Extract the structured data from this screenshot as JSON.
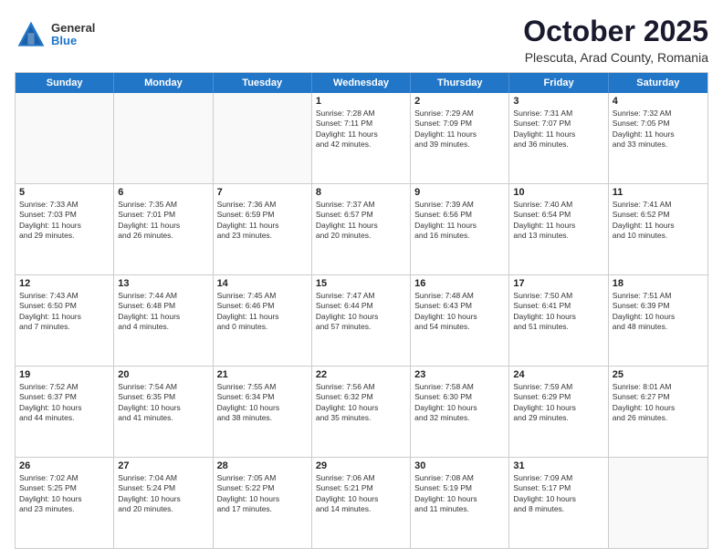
{
  "header": {
    "logo": {
      "general": "General",
      "blue": "Blue"
    },
    "title": "October 2025",
    "subtitle": "Plescuta, Arad County, Romania"
  },
  "weekdays": [
    "Sunday",
    "Monday",
    "Tuesday",
    "Wednesday",
    "Thursday",
    "Friday",
    "Saturday"
  ],
  "rows": [
    [
      {
        "day": "",
        "lines": [],
        "empty": true
      },
      {
        "day": "",
        "lines": [],
        "empty": true
      },
      {
        "day": "",
        "lines": [],
        "empty": true
      },
      {
        "day": "1",
        "lines": [
          "Sunrise: 7:28 AM",
          "Sunset: 7:11 PM",
          "Daylight: 11 hours",
          "and 42 minutes."
        ],
        "empty": false
      },
      {
        "day": "2",
        "lines": [
          "Sunrise: 7:29 AM",
          "Sunset: 7:09 PM",
          "Daylight: 11 hours",
          "and 39 minutes."
        ],
        "empty": false
      },
      {
        "day": "3",
        "lines": [
          "Sunrise: 7:31 AM",
          "Sunset: 7:07 PM",
          "Daylight: 11 hours",
          "and 36 minutes."
        ],
        "empty": false
      },
      {
        "day": "4",
        "lines": [
          "Sunrise: 7:32 AM",
          "Sunset: 7:05 PM",
          "Daylight: 11 hours",
          "and 33 minutes."
        ],
        "empty": false
      }
    ],
    [
      {
        "day": "5",
        "lines": [
          "Sunrise: 7:33 AM",
          "Sunset: 7:03 PM",
          "Daylight: 11 hours",
          "and 29 minutes."
        ],
        "empty": false
      },
      {
        "day": "6",
        "lines": [
          "Sunrise: 7:35 AM",
          "Sunset: 7:01 PM",
          "Daylight: 11 hours",
          "and 26 minutes."
        ],
        "empty": false
      },
      {
        "day": "7",
        "lines": [
          "Sunrise: 7:36 AM",
          "Sunset: 6:59 PM",
          "Daylight: 11 hours",
          "and 23 minutes."
        ],
        "empty": false
      },
      {
        "day": "8",
        "lines": [
          "Sunrise: 7:37 AM",
          "Sunset: 6:57 PM",
          "Daylight: 11 hours",
          "and 20 minutes."
        ],
        "empty": false
      },
      {
        "day": "9",
        "lines": [
          "Sunrise: 7:39 AM",
          "Sunset: 6:56 PM",
          "Daylight: 11 hours",
          "and 16 minutes."
        ],
        "empty": false
      },
      {
        "day": "10",
        "lines": [
          "Sunrise: 7:40 AM",
          "Sunset: 6:54 PM",
          "Daylight: 11 hours",
          "and 13 minutes."
        ],
        "empty": false
      },
      {
        "day": "11",
        "lines": [
          "Sunrise: 7:41 AM",
          "Sunset: 6:52 PM",
          "Daylight: 11 hours",
          "and 10 minutes."
        ],
        "empty": false
      }
    ],
    [
      {
        "day": "12",
        "lines": [
          "Sunrise: 7:43 AM",
          "Sunset: 6:50 PM",
          "Daylight: 11 hours",
          "and 7 minutes."
        ],
        "empty": false
      },
      {
        "day": "13",
        "lines": [
          "Sunrise: 7:44 AM",
          "Sunset: 6:48 PM",
          "Daylight: 11 hours",
          "and 4 minutes."
        ],
        "empty": false
      },
      {
        "day": "14",
        "lines": [
          "Sunrise: 7:45 AM",
          "Sunset: 6:46 PM",
          "Daylight: 11 hours",
          "and 0 minutes."
        ],
        "empty": false
      },
      {
        "day": "15",
        "lines": [
          "Sunrise: 7:47 AM",
          "Sunset: 6:44 PM",
          "Daylight: 10 hours",
          "and 57 minutes."
        ],
        "empty": false
      },
      {
        "day": "16",
        "lines": [
          "Sunrise: 7:48 AM",
          "Sunset: 6:43 PM",
          "Daylight: 10 hours",
          "and 54 minutes."
        ],
        "empty": false
      },
      {
        "day": "17",
        "lines": [
          "Sunrise: 7:50 AM",
          "Sunset: 6:41 PM",
          "Daylight: 10 hours",
          "and 51 minutes."
        ],
        "empty": false
      },
      {
        "day": "18",
        "lines": [
          "Sunrise: 7:51 AM",
          "Sunset: 6:39 PM",
          "Daylight: 10 hours",
          "and 48 minutes."
        ],
        "empty": false
      }
    ],
    [
      {
        "day": "19",
        "lines": [
          "Sunrise: 7:52 AM",
          "Sunset: 6:37 PM",
          "Daylight: 10 hours",
          "and 44 minutes."
        ],
        "empty": false
      },
      {
        "day": "20",
        "lines": [
          "Sunrise: 7:54 AM",
          "Sunset: 6:35 PM",
          "Daylight: 10 hours",
          "and 41 minutes."
        ],
        "empty": false
      },
      {
        "day": "21",
        "lines": [
          "Sunrise: 7:55 AM",
          "Sunset: 6:34 PM",
          "Daylight: 10 hours",
          "and 38 minutes."
        ],
        "empty": false
      },
      {
        "day": "22",
        "lines": [
          "Sunrise: 7:56 AM",
          "Sunset: 6:32 PM",
          "Daylight: 10 hours",
          "and 35 minutes."
        ],
        "empty": false
      },
      {
        "day": "23",
        "lines": [
          "Sunrise: 7:58 AM",
          "Sunset: 6:30 PM",
          "Daylight: 10 hours",
          "and 32 minutes."
        ],
        "empty": false
      },
      {
        "day": "24",
        "lines": [
          "Sunrise: 7:59 AM",
          "Sunset: 6:29 PM",
          "Daylight: 10 hours",
          "and 29 minutes."
        ],
        "empty": false
      },
      {
        "day": "25",
        "lines": [
          "Sunrise: 8:01 AM",
          "Sunset: 6:27 PM",
          "Daylight: 10 hours",
          "and 26 minutes."
        ],
        "empty": false
      }
    ],
    [
      {
        "day": "26",
        "lines": [
          "Sunrise: 7:02 AM",
          "Sunset: 5:25 PM",
          "Daylight: 10 hours",
          "and 23 minutes."
        ],
        "empty": false
      },
      {
        "day": "27",
        "lines": [
          "Sunrise: 7:04 AM",
          "Sunset: 5:24 PM",
          "Daylight: 10 hours",
          "and 20 minutes."
        ],
        "empty": false
      },
      {
        "day": "28",
        "lines": [
          "Sunrise: 7:05 AM",
          "Sunset: 5:22 PM",
          "Daylight: 10 hours",
          "and 17 minutes."
        ],
        "empty": false
      },
      {
        "day": "29",
        "lines": [
          "Sunrise: 7:06 AM",
          "Sunset: 5:21 PM",
          "Daylight: 10 hours",
          "and 14 minutes."
        ],
        "empty": false
      },
      {
        "day": "30",
        "lines": [
          "Sunrise: 7:08 AM",
          "Sunset: 5:19 PM",
          "Daylight: 10 hours",
          "and 11 minutes."
        ],
        "empty": false
      },
      {
        "day": "31",
        "lines": [
          "Sunrise: 7:09 AM",
          "Sunset: 5:17 PM",
          "Daylight: 10 hours",
          "and 8 minutes."
        ],
        "empty": false
      },
      {
        "day": "",
        "lines": [],
        "empty": true
      }
    ]
  ]
}
